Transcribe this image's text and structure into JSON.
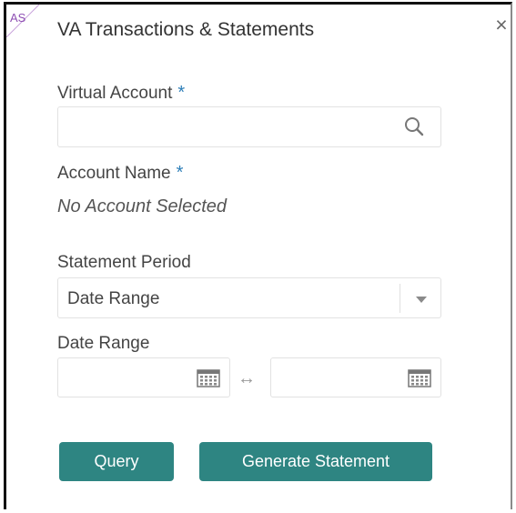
{
  "badge": "AS",
  "title": "VA Transactions & Statements",
  "close_glyph": "×",
  "virtual_account": {
    "label": "Virtual Account",
    "required": "*",
    "value": "",
    "icon": "search-icon"
  },
  "account_name": {
    "label": "Account Name",
    "required": "*",
    "value": "No Account Selected"
  },
  "statement_period": {
    "label": "Statement Period",
    "selected": "Date Range",
    "icon": "chevron-down-icon"
  },
  "date_range": {
    "label": "Date Range",
    "from": "",
    "to": "",
    "separator": "↔",
    "icon": "calendar-icon"
  },
  "buttons": {
    "query": "Query",
    "generate": "Generate Statement"
  },
  "colors": {
    "accent": "#2e8582",
    "required": "#2e7fb8",
    "badge": "#8e4fb3"
  }
}
